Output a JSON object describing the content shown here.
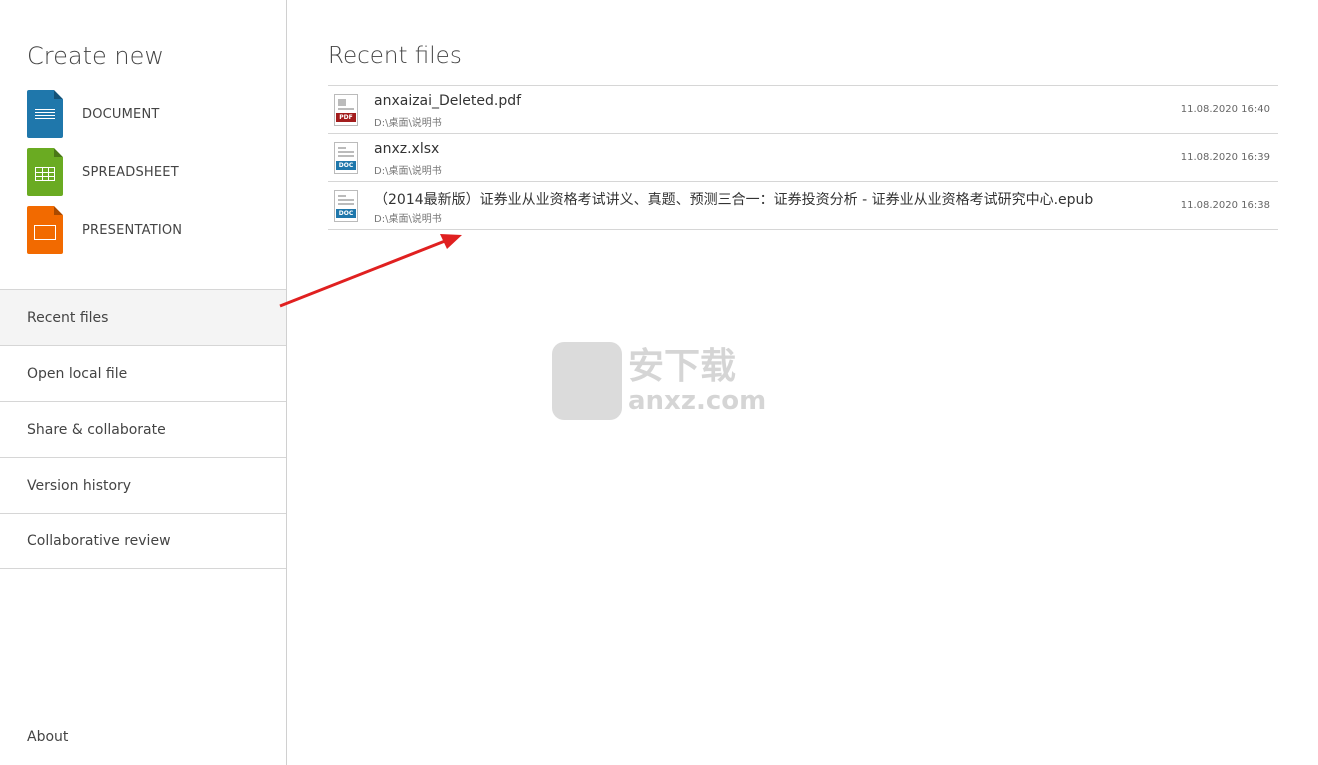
{
  "sidebar": {
    "create_title": "Create new",
    "create_items": [
      {
        "label": "DOCUMENT",
        "icon": "document-icon",
        "color": "#1f77ab"
      },
      {
        "label": "SPREADSHEET",
        "icon": "spreadsheet-icon",
        "color": "#6aab22"
      },
      {
        "label": "PRESENTATION",
        "icon": "presentation-icon",
        "color": "#f26a00"
      }
    ],
    "nav": [
      {
        "label": "Recent files",
        "active": true
      },
      {
        "label": "Open local file"
      },
      {
        "label": "Share & collaborate"
      },
      {
        "label": "Version history"
      },
      {
        "label": "Collaborative review"
      }
    ],
    "about": "About"
  },
  "main": {
    "title": "Recent files",
    "files": [
      {
        "name": "anxaizai_Deleted.pdf",
        "path": "D:\\桌面\\说明书",
        "date": "11.08.2020 16:40",
        "type": "PDF",
        "badge_color": "#a31d1d"
      },
      {
        "name": "anxz.xlsx",
        "path": "D:\\桌面\\说明书",
        "date": "11.08.2020 16:39",
        "type": "DOC",
        "badge_color": "#1f77ab"
      },
      {
        "name": "（2014最新版）证券业从业资格考试讲义、真题、预测三合一：证券投资分析 - 证券业从业资格考试研究中心.epub",
        "path": "D:\\桌面\\说明书",
        "date": "11.08.2020 16:38",
        "type": "DOC",
        "badge_color": "#1f77ab"
      }
    ]
  },
  "watermark": {
    "cn": "安下载",
    "en": "anxz.com"
  }
}
